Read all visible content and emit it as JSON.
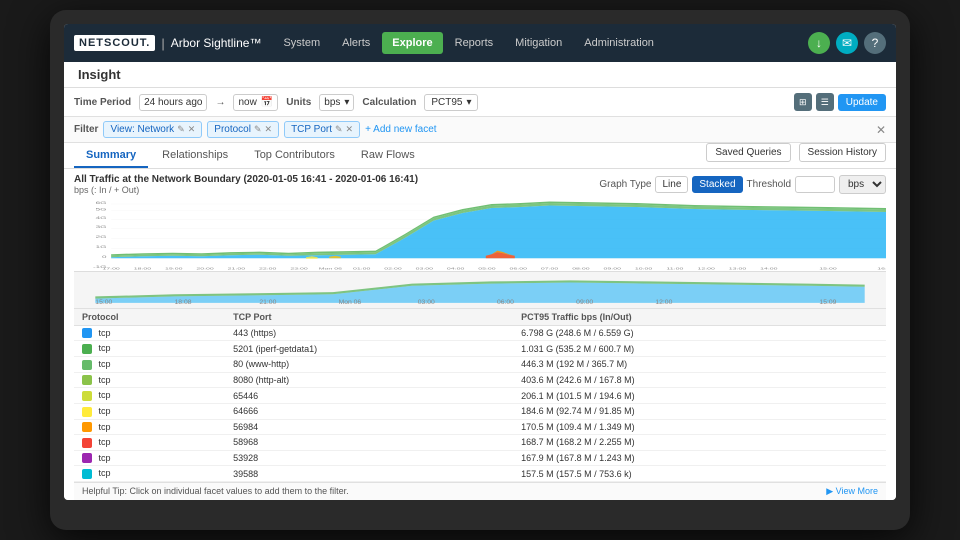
{
  "brand": {
    "logo": "NETSCOUT.",
    "separator": "|",
    "name": "Arbor Sightline™"
  },
  "nav": {
    "items": [
      {
        "label": "System",
        "active": false
      },
      {
        "label": "Alerts",
        "active": false
      },
      {
        "label": "Explore",
        "active": true
      },
      {
        "label": "Reports",
        "active": false
      },
      {
        "label": "Mitigation",
        "active": false
      },
      {
        "label": "Administration",
        "active": false
      }
    ],
    "icons": [
      {
        "name": "download-icon",
        "symbol": "↓"
      },
      {
        "name": "email-icon",
        "symbol": "✉"
      },
      {
        "name": "help-icon",
        "symbol": "?"
      }
    ]
  },
  "page": {
    "title": "Insight"
  },
  "toolbar": {
    "period_label": "Time Period",
    "period_from": "24 hours ago",
    "period_arrow": "→",
    "period_to": "now",
    "units_label": "Units",
    "units_value": "bps",
    "calc_label": "Calculation",
    "calc_value": "PCT95",
    "update_label": "Update"
  },
  "filter": {
    "label": "Filter",
    "tags": [
      {
        "label": "View: Network",
        "editable": true,
        "removable": true
      },
      {
        "label": "Protocol",
        "editable": true,
        "removable": true
      },
      {
        "label": "TCP Port",
        "editable": true,
        "removable": true
      }
    ],
    "add_label": "+ Add new facet"
  },
  "tabs": {
    "items": [
      {
        "label": "Summary",
        "active": true
      },
      {
        "label": "Relationships",
        "active": false
      },
      {
        "label": "Top Contributors",
        "active": false
      },
      {
        "label": "Raw Flows",
        "active": false
      }
    ],
    "saved_queries_label": "Saved Queries",
    "session_history_label": "Session History"
  },
  "chart": {
    "title": "All Traffic at the Network Boundary (2020-01-05 16:41 - 2020-01-06 16:41)",
    "y_axis_unit": "bps (: In / + Out)",
    "graph_type_label": "Graph Type",
    "line_label": "Line",
    "stacked_label": "Stacked",
    "threshold_label": "Threshold",
    "threshold_unit": "bps",
    "x_labels": [
      "17:00",
      "18:00",
      "19:00",
      "20:00",
      "21:00",
      "22:00",
      "23:00",
      "Mon 06",
      "01:00",
      "02:00",
      "03:00",
      "04:00",
      "05:00",
      "06:00",
      "07:00",
      "08:00",
      "09:00",
      "10:00",
      "11:00",
      "12:00",
      "13:00",
      "14:00",
      "15:00",
      "16:00"
    ],
    "y_labels": [
      "-1G",
      "0",
      "1G",
      "2G",
      "3G",
      "4G",
      "5G",
      "6G",
      "7G"
    ]
  },
  "mini_timeline": {
    "x_labels": [
      "15:00",
      "18:08",
      "21:00",
      "Mon 06",
      "03:00",
      "06:00",
      "09:00",
      "12:00",
      "15:09"
    ]
  },
  "table": {
    "headers": [
      "Protocol",
      "TCP Port",
      "PCT95 Traffic bps (In/Out)"
    ],
    "rows": [
      {
        "color": "#2196f3",
        "protocol": "tcp",
        "port": "443 (https)",
        "traffic": "6.798 G (248.6 M / 6.559 G)"
      },
      {
        "color": "#4caf50",
        "protocol": "tcp",
        "port": "5201 (iperf-getdata1)",
        "traffic": "1.031 G (535.2 M / 600.7 M)"
      },
      {
        "color": "#66bb6a",
        "protocol": "tcp",
        "port": "80 (www-http)",
        "traffic": "446.3 M (192 M / 365.7 M)"
      },
      {
        "color": "#8bc34a",
        "protocol": "tcp",
        "port": "8080 (http-alt)",
        "traffic": "403.6 M (242.6 M / 167.8 M)"
      },
      {
        "color": "#cddc39",
        "protocol": "tcp",
        "port": "65446",
        "traffic": "206.1 M (101.5 M / 194.6 M)"
      },
      {
        "color": "#ffeb3b",
        "protocol": "tcp",
        "port": "64666",
        "traffic": "184.6 M (92.74 M / 91.85 M)"
      },
      {
        "color": "#ff9800",
        "protocol": "tcp",
        "port": "56984",
        "traffic": "170.5 M (109.4 M / 1.349 M)"
      },
      {
        "color": "#f44336",
        "protocol": "tcp",
        "port": "58968",
        "traffic": "168.7 M (168.2 M / 2.255 M)"
      },
      {
        "color": "#9c27b0",
        "protocol": "tcp",
        "port": "53928",
        "traffic": "167.9 M (167.8 M / 1.243 M)"
      },
      {
        "color": "#00bcd4",
        "protocol": "tcp",
        "port": "39588",
        "traffic": "157.5 M (157.5 M / 753.6 k)"
      }
    ]
  },
  "helpful_tip": {
    "text": "Helpful Tip: Click on individual facet values to add them to the filter.",
    "view_more": "▶ View More"
  }
}
